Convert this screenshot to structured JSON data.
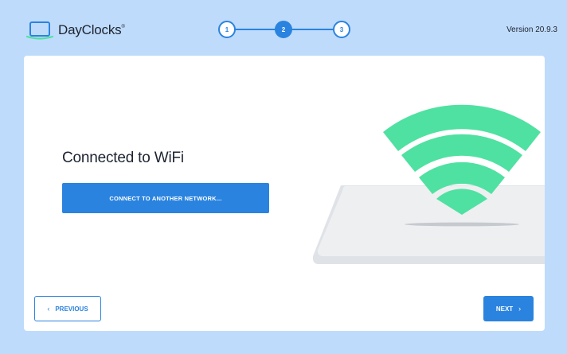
{
  "header": {
    "brand": "DayClocks",
    "trademark": "®",
    "version": "Version 20.9.3",
    "logo_icon": "laptop-icon"
  },
  "stepper": {
    "steps": [
      "1",
      "2",
      "3"
    ],
    "current_step": 2
  },
  "main": {
    "heading": "Connected to WiFi",
    "connect_button": "CONNECT TO ANOTHER NETWORK...",
    "illustration_icon": "wifi-icon"
  },
  "footer": {
    "previous_label": "PREVIOUS",
    "previous_icon": "chevron-left-icon",
    "next_label": "NEXT",
    "next_icon": "chevron-right-icon"
  },
  "colors": {
    "background": "#bfdbfb",
    "accent": "#2a83df",
    "wifi": "#4fe1a1",
    "card": "#ffffff"
  }
}
